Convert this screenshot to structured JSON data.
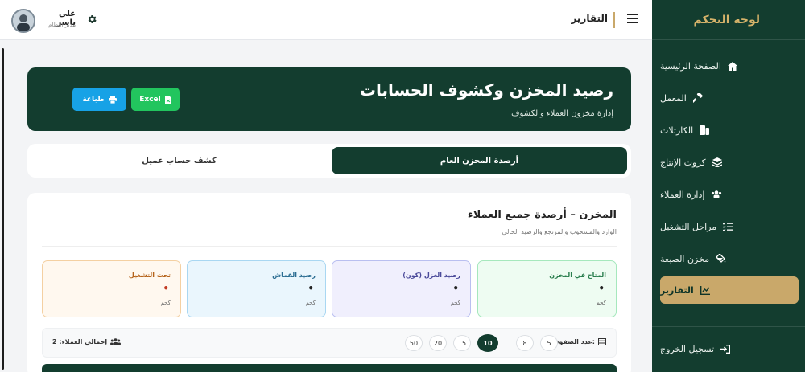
{
  "sidebar": {
    "title": "لوحة التحكم",
    "items": [
      {
        "label": "الصفحة الرئيسية",
        "icon": "home-icon"
      },
      {
        "label": "المعمل",
        "icon": "hammer-icon"
      },
      {
        "label": "الكارتلات",
        "icon": "cards-icon"
      },
      {
        "label": "كروت الإنتاج",
        "icon": "layers-icon"
      },
      {
        "label": "إدارة العملاء",
        "icon": "users-icon"
      },
      {
        "label": "مراحل التشغيل",
        "icon": "checklist-icon"
      },
      {
        "label": "مخزن الصبغة",
        "icon": "paint-icon"
      },
      {
        "label": "التقارير",
        "icon": "chart-icon",
        "active": true
      }
    ],
    "logout": "تسجيل الخروج"
  },
  "topbar": {
    "title": "التقارير",
    "user_name": "علي ياسر",
    "user_role": "مدير النظام"
  },
  "banner": {
    "title": "رصيد المخزن وكشوف الحسابات",
    "subtitle": "إدارة مخزون العملاء والكشوف",
    "excel_label": "Excel",
    "print_label": "طباعة"
  },
  "tabs": {
    "active": "أرصدة المخزن العام",
    "other": "كشف حساب عميل"
  },
  "card": {
    "title": "المخزن – أرصدة جميع العملاء",
    "subtitle": "الوارد والمسحوب والمرتجع والرصيد الحالي",
    "stats": [
      {
        "label": "المتاح في المخزن",
        "value": "•",
        "unit": "كجم"
      },
      {
        "label": "رصيد الغزل (كون)",
        "value": "•",
        "unit": "كجم"
      },
      {
        "label": "رصيد القماش",
        "value": "•",
        "unit": "كجم"
      },
      {
        "label": "تحت التشغيل",
        "value": "•",
        "unit": "كجم"
      }
    ],
    "rows_label": "عدد الصفوف:",
    "page_sizes": [
      "5",
      "8",
      "10",
      "15",
      "20",
      "50"
    ],
    "selected_page_size": "10",
    "total_label": "إجمالي العملاء: 2"
  },
  "colors": {
    "primary": "#133d2f",
    "gold": "#c9a86a",
    "excel": "#22c55e",
    "print": "#17a2e6"
  }
}
